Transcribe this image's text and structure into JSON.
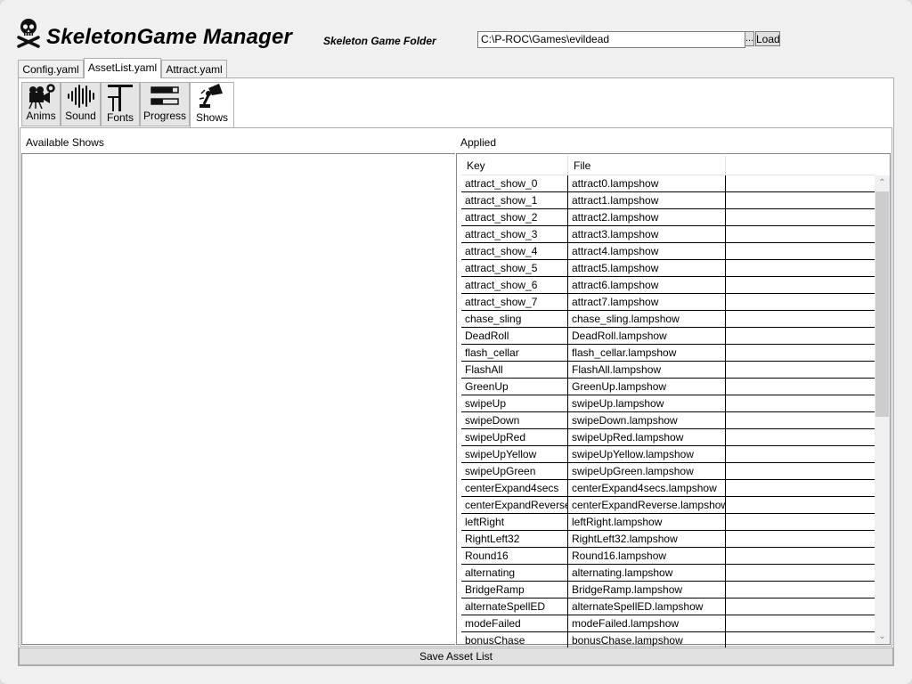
{
  "app": {
    "title": "SkeletonGame Manager",
    "folder_label": "Skeleton Game Folder",
    "folder_path": "C:\\P-ROC\\Games\\evildead",
    "browse_label": "...",
    "load_label": "Load",
    "logo_icon": "skull-crossbones-icon"
  },
  "tabs": [
    {
      "label": "Config.yaml",
      "active": false
    },
    {
      "label": "AssetList.yaml",
      "active": true
    },
    {
      "label": "Attract.yaml",
      "active": false
    }
  ],
  "asset_tabs": [
    {
      "label": "Anims",
      "icon": "camera-gear-icon",
      "active": false
    },
    {
      "label": "Sound",
      "icon": "waveform-icon",
      "active": false
    },
    {
      "label": "Fonts",
      "icon": "font-icon",
      "active": false
    },
    {
      "label": "Progress",
      "icon": "progress-bars-icon",
      "active": false
    },
    {
      "label": "Shows",
      "icon": "spotlight-icon",
      "active": true
    }
  ],
  "available_label": "Available Shows",
  "applied_label": "Applied",
  "grid": {
    "columns": [
      "Key",
      "File"
    ],
    "rows": [
      {
        "key": "attract_show_0",
        "file": "attract0.lampshow"
      },
      {
        "key": "attract_show_1",
        "file": "attract1.lampshow"
      },
      {
        "key": "attract_show_2",
        "file": "attract2.lampshow"
      },
      {
        "key": "attract_show_3",
        "file": "attract3.lampshow"
      },
      {
        "key": "attract_show_4",
        "file": "attract4.lampshow"
      },
      {
        "key": "attract_show_5",
        "file": "attract5.lampshow"
      },
      {
        "key": "attract_show_6",
        "file": "attract6.lampshow"
      },
      {
        "key": "attract_show_7",
        "file": "attract7.lampshow"
      },
      {
        "key": "chase_sling",
        "file": "chase_sling.lampshow"
      },
      {
        "key": "DeadRoll",
        "file": "DeadRoll.lampshow"
      },
      {
        "key": "flash_cellar",
        "file": "flash_cellar.lampshow"
      },
      {
        "key": "FlashAll",
        "file": "FlashAll.lampshow"
      },
      {
        "key": "GreenUp",
        "file": "GreenUp.lampshow"
      },
      {
        "key": "swipeUp",
        "file": "swipeUp.lampshow"
      },
      {
        "key": "swipeDown",
        "file": "swipeDown.lampshow"
      },
      {
        "key": "swipeUpRed",
        "file": "swipeUpRed.lampshow"
      },
      {
        "key": "swipeUpYellow",
        "file": "swipeUpYellow.lampshow"
      },
      {
        "key": "swipeUpGreen",
        "file": "swipeUpGreen.lampshow"
      },
      {
        "key": "centerExpand4secs",
        "file": "centerExpand4secs.lampshow"
      },
      {
        "key": "centerExpandReverse",
        "file": "centerExpandReverse.lampshow"
      },
      {
        "key": "leftRight",
        "file": "leftRight.lampshow"
      },
      {
        "key": "RightLeft32",
        "file": "RightLeft32.lampshow"
      },
      {
        "key": "Round16",
        "file": "Round16.lampshow"
      },
      {
        "key": "alternating",
        "file": "alternating.lampshow"
      },
      {
        "key": "BridgeRamp",
        "file": "BridgeRamp.lampshow"
      },
      {
        "key": "alternateSpellED",
        "file": "alternateSpellED.lampshow"
      },
      {
        "key": "modeFailed",
        "file": "modeFailed.lampshow"
      },
      {
        "key": "bonusChase",
        "file": "bonusChase.lampshow"
      }
    ]
  },
  "save_label": "Save Asset List"
}
